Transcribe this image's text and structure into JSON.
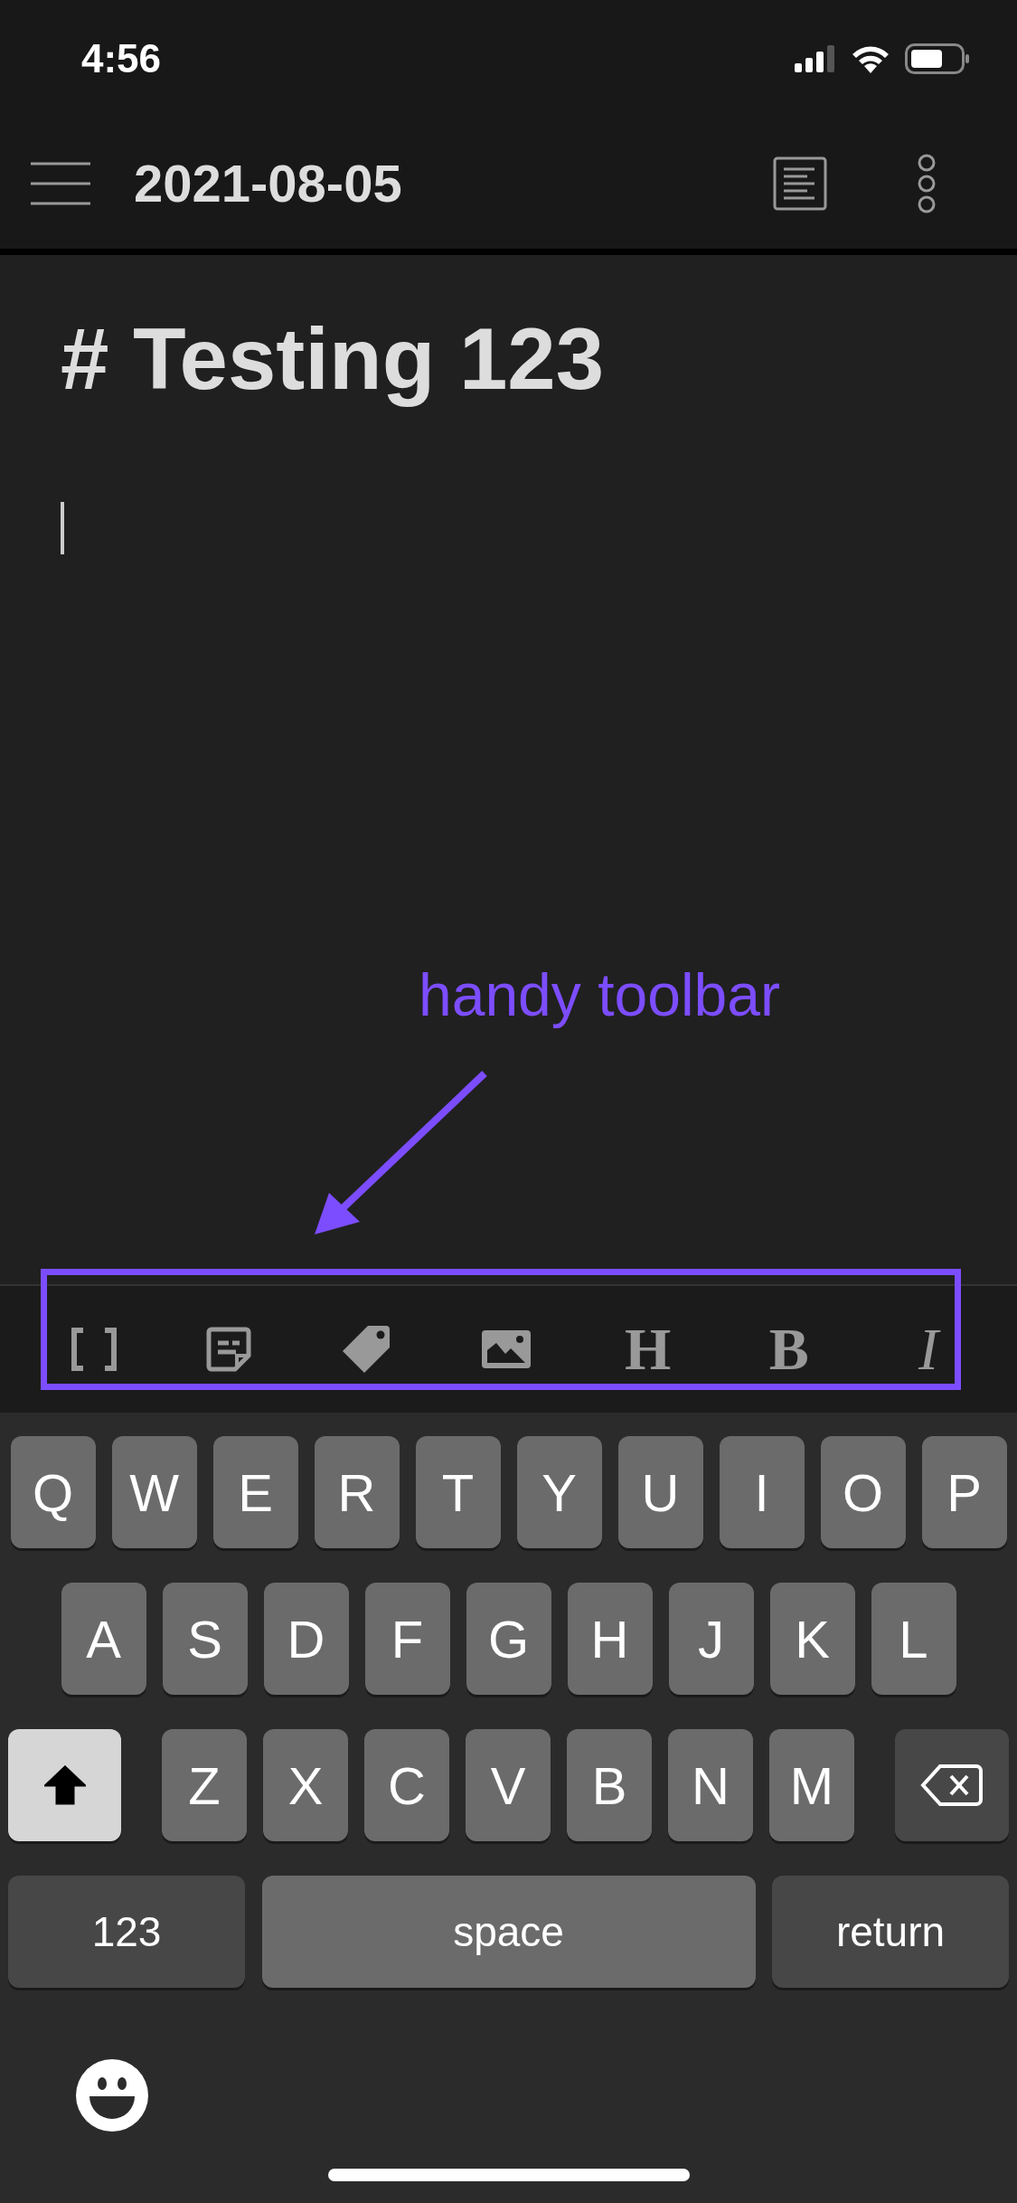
{
  "status_bar": {
    "time": "4:56"
  },
  "nav_bar": {
    "title": "2021-08-05"
  },
  "editor": {
    "heading": "# Testing 123",
    "cursor": true
  },
  "annotation": {
    "text": "handy toolbar"
  },
  "toolbar": [
    {
      "kind": "brackets"
    },
    {
      "kind": "note"
    },
    {
      "kind": "tag"
    },
    {
      "kind": "image"
    },
    {
      "kind": "heading",
      "label": "H"
    },
    {
      "kind": "bold",
      "label": "B"
    },
    {
      "kind": "italic",
      "label": "I"
    }
  ],
  "keyboard": {
    "rows": [
      [
        "Q",
        "W",
        "E",
        "R",
        "T",
        "Y",
        "U",
        "I",
        "O",
        "P"
      ],
      [
        "A",
        "S",
        "D",
        "F",
        "G",
        "H",
        "J",
        "K",
        "L"
      ],
      [
        "Z",
        "X",
        "C",
        "V",
        "B",
        "N",
        "M"
      ]
    ],
    "shift": {
      "on": true
    },
    "bottom": {
      "numbers": "123",
      "space": "space",
      "return": "return"
    }
  }
}
